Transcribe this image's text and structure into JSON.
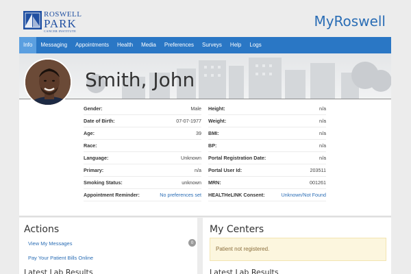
{
  "header": {
    "logo": {
      "line1": "ROSWELL",
      "line2": "PARK",
      "line3": "CANCER INSTITUTE"
    },
    "app_title": "MyRoswell",
    "brand_color": "#2a6db5"
  },
  "nav": {
    "items": [
      {
        "label": "Info",
        "active": true
      },
      {
        "label": "Messaging",
        "active": false
      },
      {
        "label": "Appointments",
        "active": false
      },
      {
        "label": "Health",
        "active": false
      },
      {
        "label": "Media",
        "active": false
      },
      {
        "label": "Preferences",
        "active": false
      },
      {
        "label": "Surveys",
        "active": false
      },
      {
        "label": "Help",
        "active": false
      },
      {
        "label": "Logs",
        "active": false
      }
    ]
  },
  "patient": {
    "name": "Smith, John",
    "left_fields": [
      {
        "label": "Gender:",
        "value": "Male"
      },
      {
        "label": "Date of Birth:",
        "value": "07-07-1977"
      },
      {
        "label": "Age:",
        "value": "39"
      },
      {
        "label": "Race:",
        "value": ""
      },
      {
        "label": "Language:",
        "value": "Unknown"
      },
      {
        "label": "Primary:",
        "value": "n/a"
      },
      {
        "label": "Smoking Status:",
        "value": "unknown"
      },
      {
        "label": "Appointment Reminder:",
        "value": "No preferences set"
      }
    ],
    "right_fields": [
      {
        "label": "Height:",
        "value": "n/a"
      },
      {
        "label": "Weight:",
        "value": "n/a"
      },
      {
        "label": "BMI:",
        "value": "n/a"
      },
      {
        "label": "BP:",
        "value": "n/a"
      },
      {
        "label": "Portal Registration Date:",
        "value": "n/a"
      },
      {
        "label": "Portal User Id:",
        "value": "203511"
      },
      {
        "label": "MRN:",
        "value": "001261"
      },
      {
        "label": "HEALTHeLINK Consent:",
        "value": "Unknown/Not Found"
      }
    ]
  },
  "actions": {
    "title": "Actions",
    "view_messages": "View My Messages",
    "message_count": "0",
    "pay_bills": "Pay Your Patient Bills Online",
    "cut_title": "Latest Lab Results"
  },
  "centers": {
    "title": "My Centers",
    "alert": "Patient not registered.",
    "cut_title": "Latest Lab Results"
  }
}
